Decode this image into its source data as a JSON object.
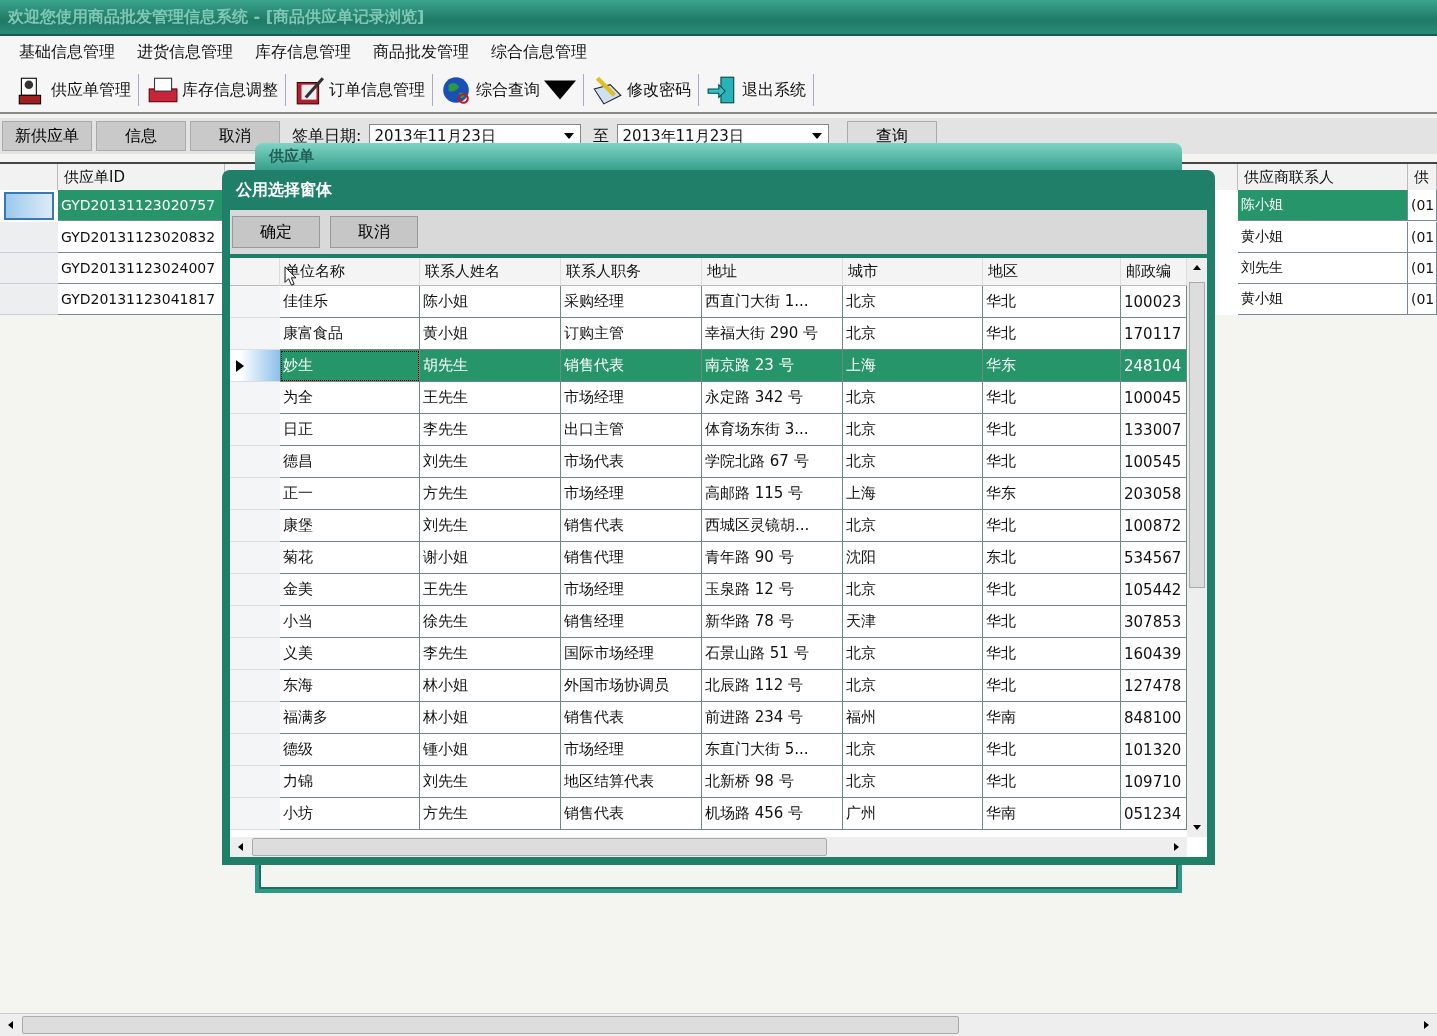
{
  "window": {
    "title": "欢迎您使用商品批发管理信息系统 - [商品供应单记录浏览]"
  },
  "menu": [
    "基础信息管理",
    "进货信息管理",
    "库存信息管理",
    "商品批发管理",
    "综合信息管理"
  ],
  "toolbar": [
    {
      "label": "供应单管理",
      "dropdown": false
    },
    {
      "label": "库存信息调整",
      "dropdown": false
    },
    {
      "label": "订单信息管理",
      "dropdown": false
    },
    {
      "label": "综合查询",
      "dropdown": true
    },
    {
      "label": "修改密码",
      "dropdown": false
    },
    {
      "label": "退出系统",
      "dropdown": false
    }
  ],
  "filter": {
    "buttons": [
      "新供应单",
      "信息",
      "取消"
    ],
    "date_label": "签单日期:",
    "from": "2013年11月23日",
    "to_label": "至",
    "to": "2013年11月23日",
    "query": "查询"
  },
  "table": {
    "columns": [
      "供应单ID",
      "供应商联系人",
      "供"
    ],
    "rows": [
      {
        "selected": true,
        "cells": [
          "GYD20131123020757",
          "陈小姐",
          "(01"
        ]
      },
      {
        "selected": false,
        "cells": [
          "GYD20131123020832",
          "黄小姐",
          "(01"
        ]
      },
      {
        "selected": false,
        "cells": [
          "GYD20131123024007",
          "刘先生",
          "(01"
        ]
      },
      {
        "selected": false,
        "cells": [
          "GYD20131123041817",
          "黄小姐",
          "(01"
        ]
      }
    ]
  },
  "back_window": {
    "title": "供应单"
  },
  "dialog": {
    "title": "公用选择窗体",
    "buttons": [
      "确定",
      "取消"
    ],
    "columns": [
      "单位名称",
      "联系人姓名",
      "联系人职务",
      "地址",
      "城市",
      "地区",
      "邮政编"
    ],
    "rows": [
      {
        "selected": false,
        "cells": [
          "佳佳乐",
          "陈小姐",
          "采购经理",
          "西直门大街 1...",
          "北京",
          "华北",
          "100023"
        ]
      },
      {
        "selected": false,
        "cells": [
          "康富食品",
          "黄小姐",
          "订购主管",
          "幸福大街 290 号",
          "北京",
          "华北",
          "170117"
        ]
      },
      {
        "selected": true,
        "cells": [
          "妙生",
          "胡先生",
          "销售代表",
          "南京路 23 号",
          "上海",
          "华东",
          "248104"
        ]
      },
      {
        "selected": false,
        "cells": [
          "为全",
          "王先生",
          "市场经理",
          "永定路 342 号",
          "北京",
          "华北",
          "100045"
        ]
      },
      {
        "selected": false,
        "cells": [
          "日正",
          "李先生",
          "出口主管",
          "体育场东街 3...",
          "北京",
          "华北",
          "133007"
        ]
      },
      {
        "selected": false,
        "cells": [
          "德昌",
          "刘先生",
          "市场代表",
          "学院北路 67 号",
          "北京",
          "华北",
          "100545"
        ]
      },
      {
        "selected": false,
        "cells": [
          "正一",
          "方先生",
          "市场经理",
          "高邮路 115 号",
          "上海",
          "华东",
          "203058"
        ]
      },
      {
        "selected": false,
        "cells": [
          "康堡",
          "刘先生",
          "销售代表",
          "西城区灵镜胡...",
          "北京",
          "华北",
          "100872"
        ]
      },
      {
        "selected": false,
        "cells": [
          "菊花",
          "谢小姐",
          "销售代理",
          "青年路 90 号",
          "沈阳",
          "东北",
          "534567"
        ]
      },
      {
        "selected": false,
        "cells": [
          "金美",
          "王先生",
          "市场经理",
          "玉泉路 12 号",
          "北京",
          "华北",
          "105442"
        ]
      },
      {
        "selected": false,
        "cells": [
          "小当",
          "徐先生",
          "销售经理",
          "新华路 78 号",
          "天津",
          "华北",
          "307853"
        ]
      },
      {
        "selected": false,
        "cells": [
          "义美",
          "李先生",
          "国际市场经理",
          "石景山路 51 号",
          "北京",
          "华北",
          "160439"
        ]
      },
      {
        "selected": false,
        "cells": [
          "东海",
          "林小姐",
          "外国市场协调员",
          "北辰路 112 号",
          "北京",
          "华北",
          "127478"
        ]
      },
      {
        "selected": false,
        "cells": [
          "福满多",
          "林小姐",
          "销售代表",
          "前进路 234 号",
          "福州",
          "华南",
          "848100"
        ]
      },
      {
        "selected": false,
        "cells": [
          "德级",
          "锺小姐",
          "市场经理",
          "东直门大街 5...",
          "北京",
          "华北",
          "101320"
        ]
      },
      {
        "selected": false,
        "cells": [
          "力锦",
          "刘先生",
          "地区结算代表",
          "北新桥 98 号",
          "北京",
          "华北",
          "109710"
        ]
      },
      {
        "selected": false,
        "cells": [
          "小坊",
          "方先生",
          "销售代表",
          "机场路 456 号",
          "广州",
          "华南",
          "051234"
        ]
      }
    ]
  }
}
